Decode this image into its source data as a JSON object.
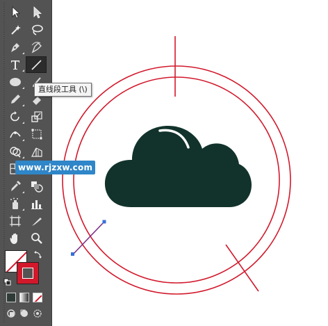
{
  "tooltip": {
    "text": "直线段工具 (\\)"
  },
  "watermark": {
    "text": "www.rjzxw.com"
  },
  "tools": [
    "selection-tool",
    "direct-selection-tool",
    "magic-wand-tool",
    "lasso-tool",
    "pen-tool",
    "curvature-tool",
    "type-tool",
    "line-segment-tool",
    "ellipse-tool",
    "paintbrush-tool",
    "pencil-tool",
    "eraser-tool",
    "rotate-tool",
    "scale-tool",
    "width-tool",
    "free-transform-tool",
    "shape-builder-tool",
    "perspective-grid-tool",
    "mesh-tool",
    "gradient-tool",
    "eyedropper-tool",
    "blend-tool",
    "symbol-sprayer-tool",
    "column-graph-tool",
    "artboard-tool",
    "slice-tool",
    "hand-tool",
    "zoom-tool"
  ],
  "colors": {
    "toolbar_bg": "#535353",
    "ring_red": "#d2182b",
    "cloud": "#12332b",
    "line_purple": "#7a2f86",
    "anchor_blue": "#3a6fd8",
    "watermark_bg": "#2f86c8"
  }
}
